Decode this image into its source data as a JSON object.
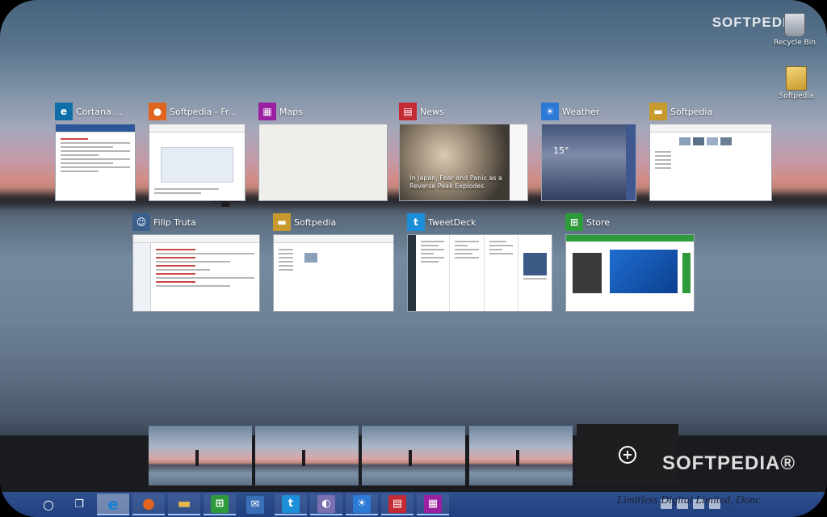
{
  "watermarks": {
    "top": "SOFTPEDIA",
    "bottom": "SOFTPEDIA®"
  },
  "desktop_icons": [
    {
      "label": "Recycle Bin",
      "icon": "recycle-bin-icon"
    },
    {
      "label": "Softpedia",
      "icon": "folder-icon"
    }
  ],
  "windows": [
    {
      "title": "Cortana ...",
      "icon": "edge-icon",
      "color": "#0e6fa8"
    },
    {
      "title": "Softpedia - Fr...",
      "icon": "firefox-icon",
      "color": "#e0631f"
    },
    {
      "title": "Maps",
      "icon": "maps-icon",
      "color": "#9b1fa1"
    },
    {
      "title": "News",
      "icon": "news-icon",
      "color": "#c42b35"
    },
    {
      "title": "Weather",
      "icon": "weather-icon",
      "color": "#2c7ad6"
    },
    {
      "title": "Softpedia",
      "icon": "folder-icon",
      "color": "#c89a2e"
    },
    {
      "title": "Filip Truta",
      "icon": "avatar-icon",
      "color": "#3a5f8c"
    },
    {
      "title": "Softpedia",
      "icon": "folder-icon",
      "color": "#c89a2e"
    },
    {
      "title": "TweetDeck",
      "icon": "twitter-icon",
      "color": "#1d8fd8"
    },
    {
      "title": "Store",
      "icon": "store-icon",
      "color": "#2f9a3c"
    }
  ],
  "news_caption": "In Japan, Fear and Panic as a Reverse Peak Explodes",
  "weather_temp": "15°",
  "virtual_desktops": {
    "count": 4,
    "add_label": "+"
  },
  "taskbar": {
    "items": [
      {
        "name": "search",
        "glyph": "○"
      },
      {
        "name": "task-view",
        "glyph": "❐"
      },
      {
        "name": "edge",
        "glyph": "e",
        "color": "#1b7fd1"
      },
      {
        "name": "firefox",
        "glyph": "●",
        "color": "#e0631f"
      },
      {
        "name": "file-explorer",
        "glyph": "▬",
        "color": "#e6b74b"
      },
      {
        "name": "store",
        "glyph": "⊞",
        "color": "#2f9a3c"
      },
      {
        "name": "thunderbird",
        "glyph": "✉",
        "color": "#3a6fb8"
      },
      {
        "name": "twitter",
        "glyph": "t",
        "color": "#1d8fd8"
      },
      {
        "name": "chat",
        "glyph": "◐",
        "color": "#7a6fb0"
      },
      {
        "name": "weather",
        "glyph": "☀",
        "color": "#2c7ad6"
      },
      {
        "name": "news",
        "glyph": "▤",
        "color": "#c42b35"
      },
      {
        "name": "maps",
        "glyph": "▦",
        "color": "#9b1fa1"
      }
    ]
  },
  "footer_text": "Limitless Digital Limited, Donc"
}
